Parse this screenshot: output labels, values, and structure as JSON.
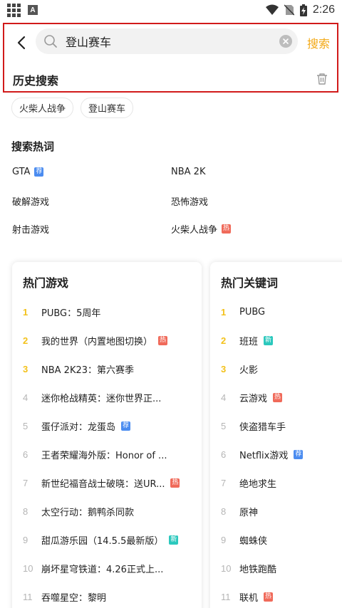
{
  "status": {
    "time": "2:26"
  },
  "search": {
    "query": "登山赛车",
    "action_label": "搜索"
  },
  "history": {
    "title": "历史搜索",
    "items": [
      "火柴人战争",
      "登山赛车"
    ]
  },
  "hot_words": {
    "title": "搜索热词",
    "items": [
      {
        "label": "GTA",
        "tag": "荐",
        "tag_color": "#4b8cf0"
      },
      {
        "label": "NBA 2K",
        "tag": "",
        "tag_color": ""
      },
      {
        "label": "破解游戏",
        "tag": "",
        "tag_color": ""
      },
      {
        "label": "恐怖游戏",
        "tag": "",
        "tag_color": ""
      },
      {
        "label": "射击游戏",
        "tag": "",
        "tag_color": ""
      },
      {
        "label": "火柴人战争",
        "tag": "热",
        "tag_color": "#f06a5a"
      }
    ]
  },
  "hot_games": {
    "title": "热门游戏",
    "items": [
      {
        "rank": "1",
        "name": "PUBG：5周年",
        "tag": ""
      },
      {
        "rank": "2",
        "name": "我的世界（内置地图切换）",
        "tag": "热"
      },
      {
        "rank": "3",
        "name": "NBA 2K23：第六赛季",
        "tag": ""
      },
      {
        "rank": "4",
        "name": "迷你枪战精英：迷你世界正...",
        "tag": ""
      },
      {
        "rank": "5",
        "name": "蛋仔派对：龙蛋岛",
        "tag": "荐"
      },
      {
        "rank": "6",
        "name": "王者荣耀海外版：Honor of ...",
        "tag": ""
      },
      {
        "rank": "7",
        "name": "新世纪福音战士破晓：送UR...",
        "tag": "热"
      },
      {
        "rank": "8",
        "name": "太空行动：鹅鸭杀同款",
        "tag": ""
      },
      {
        "rank": "9",
        "name": "甜瓜游乐园（14.5.5最新版）",
        "tag": "新"
      },
      {
        "rank": "10",
        "name": "崩坏星穹铁道：4.26正式上...",
        "tag": ""
      },
      {
        "rank": "11",
        "name": "吞噬星空：黎明",
        "tag": ""
      }
    ]
  },
  "hot_keywords": {
    "title": "热门关键词",
    "items": [
      {
        "rank": "1",
        "name": "PUBG",
        "tag": ""
      },
      {
        "rank": "2",
        "name": "班班",
        "tag": "新"
      },
      {
        "rank": "3",
        "name": "火影",
        "tag": ""
      },
      {
        "rank": "4",
        "name": "云游戏",
        "tag": "热"
      },
      {
        "rank": "5",
        "name": "侠盗猎车手",
        "tag": ""
      },
      {
        "rank": "6",
        "name": "Netflix游戏",
        "tag": "荐"
      },
      {
        "rank": "7",
        "name": "绝地求生",
        "tag": ""
      },
      {
        "rank": "8",
        "name": "原神",
        "tag": ""
      },
      {
        "rank": "9",
        "name": "蜘蛛侠",
        "tag": ""
      },
      {
        "rank": "10",
        "name": "地铁跑酷",
        "tag": ""
      },
      {
        "rank": "11",
        "name": "联机",
        "tag": "热"
      }
    ]
  },
  "colors": {
    "accent": "#f3a916",
    "rank_top": "#f3c11a",
    "tag_hot": "#f06a5a",
    "tag_recommend": "#4b8cf0",
    "tag_new": "#2bc8bd",
    "highlight_frame": "#d11a1a"
  }
}
